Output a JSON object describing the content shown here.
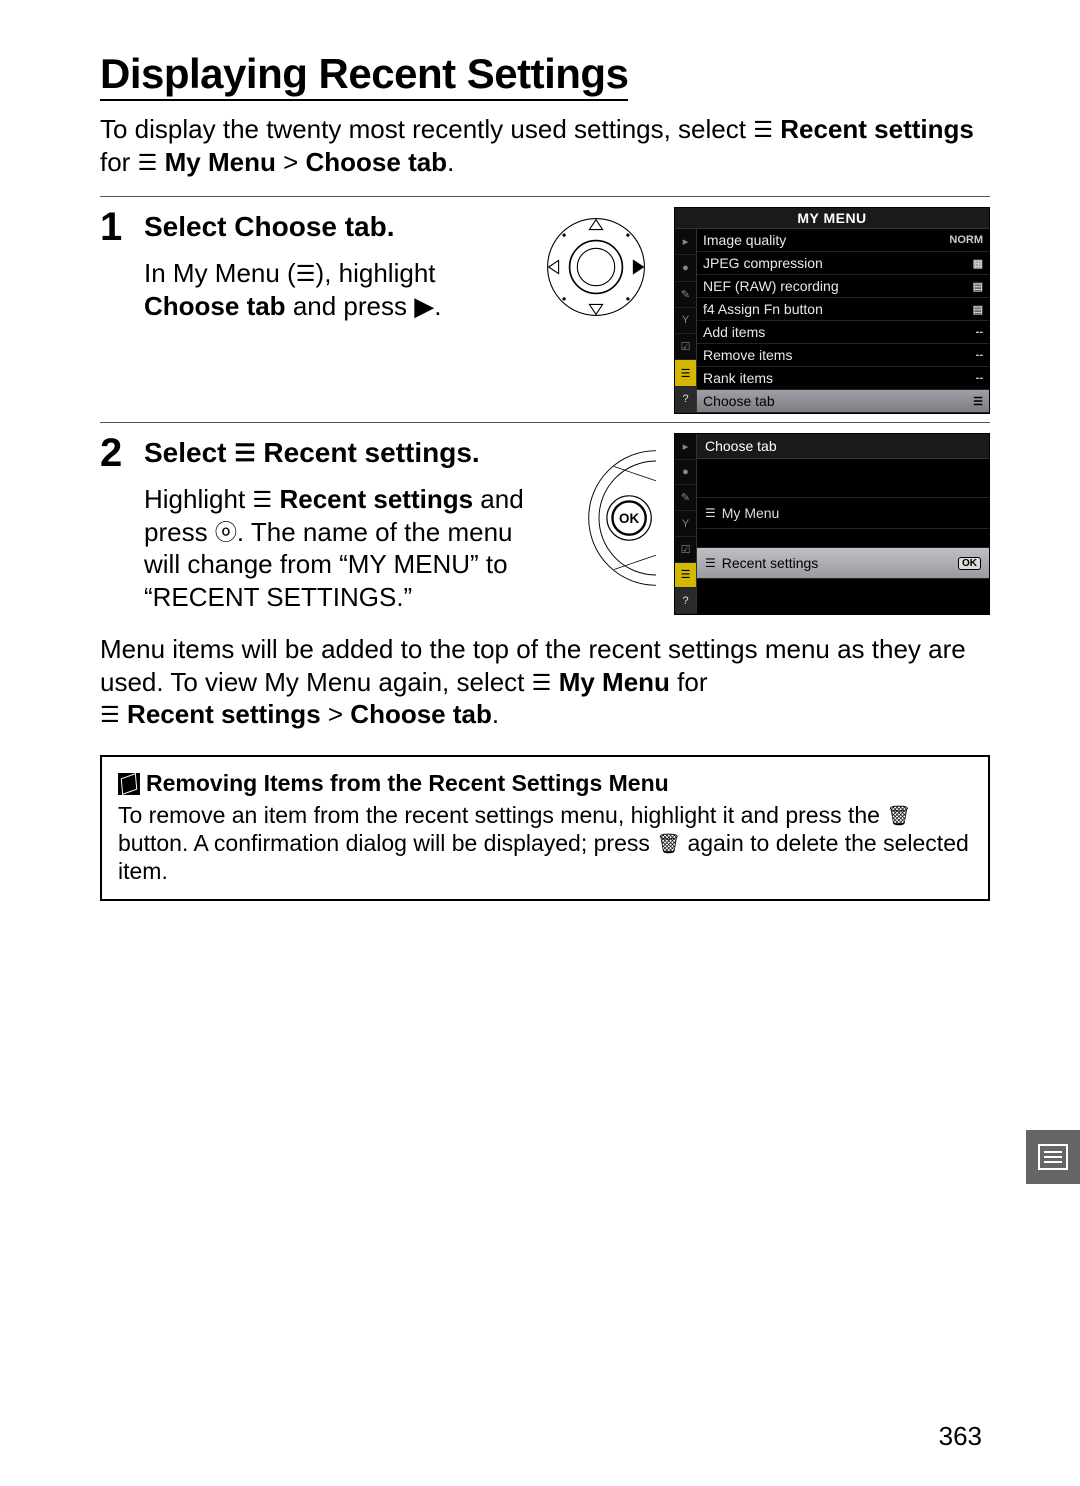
{
  "title": "Displaying Recent Settings",
  "intro": {
    "part1": "To display the twenty most recently used settings, select ",
    "bold1": "Recent settings",
    "part2": " for ",
    "bold2": "My Menu",
    "bold3": "Choose tab",
    "period": "."
  },
  "steps": [
    {
      "num": "1",
      "title_pre": "Select",
      "title_bold": "Choose tab",
      "title_post": ".",
      "desc1": "In My Menu",
      "desc2": ", highlight ",
      "desc_bold": "Choose tab",
      "desc3": " and press ",
      "desc4": "."
    },
    {
      "num": "2",
      "title_pre": "Select ",
      "title_bold": "Recent settings",
      "title_post": ".",
      "desc1": "Highlight ",
      "desc_bold": "Recent settings",
      "desc2": " and press ",
      "desc3": ".  The name of the menu will change from “MY MENU” to “RECENT SETTINGS.”"
    }
  ],
  "menu1": {
    "title": "MY MENU",
    "items": [
      {
        "label": "Image quality",
        "val": "NORM"
      },
      {
        "label": "JPEG compression",
        "val": ""
      },
      {
        "label": "NEF (RAW) recording",
        "val": ""
      },
      {
        "label": "f4 Assign Fn button",
        "val": ""
      },
      {
        "label": "Add items",
        "val": "--"
      },
      {
        "label": "Remove items",
        "val": "--"
      },
      {
        "label": "Rank items",
        "val": "--"
      },
      {
        "label": "Choose tab",
        "val": ""
      }
    ]
  },
  "menu2": {
    "title": "Choose tab",
    "items": [
      "My Menu",
      "Recent settings"
    ],
    "ok": "OK"
  },
  "closing": {
    "part1": "Menu items will be added to the top of the recent settings menu as they are used.  To view My Menu again, select ",
    "bold1": "My Menu",
    "part2": " for",
    "bold2": "Recent settings",
    "bold3": "Choose tab",
    "period": "."
  },
  "note": {
    "heading": "Removing Items from the Recent Settings Menu",
    "body1": "To remove an item from the recent settings menu, highlight it and press the ",
    "body2": " button.  A confirmation dialog will be displayed; press ",
    "body3": " again to delete the selected item."
  },
  "page_number": "363"
}
